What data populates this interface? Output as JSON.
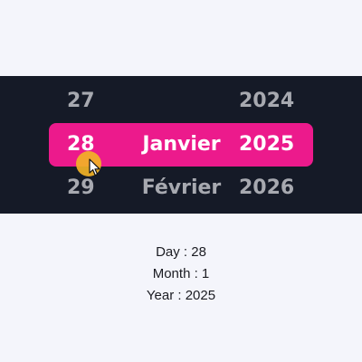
{
  "picker": {
    "day_column": [
      "27",
      "28",
      "29"
    ],
    "month_column": [
      "",
      "Janvier",
      "Février"
    ],
    "year_column": [
      "2024",
      "2025",
      "2026"
    ],
    "selected_row": 1
  },
  "readout": {
    "day": "Day : 28",
    "month": "Month : 1",
    "year": "Year : 2025"
  },
  "colors": {
    "band_background": "#151a27",
    "selection_highlight": "#ec1a8c",
    "page_background": "#f4f5fb"
  },
  "icons": [
    "touch-indicator-icon",
    "mouse-cursor-icon"
  ]
}
